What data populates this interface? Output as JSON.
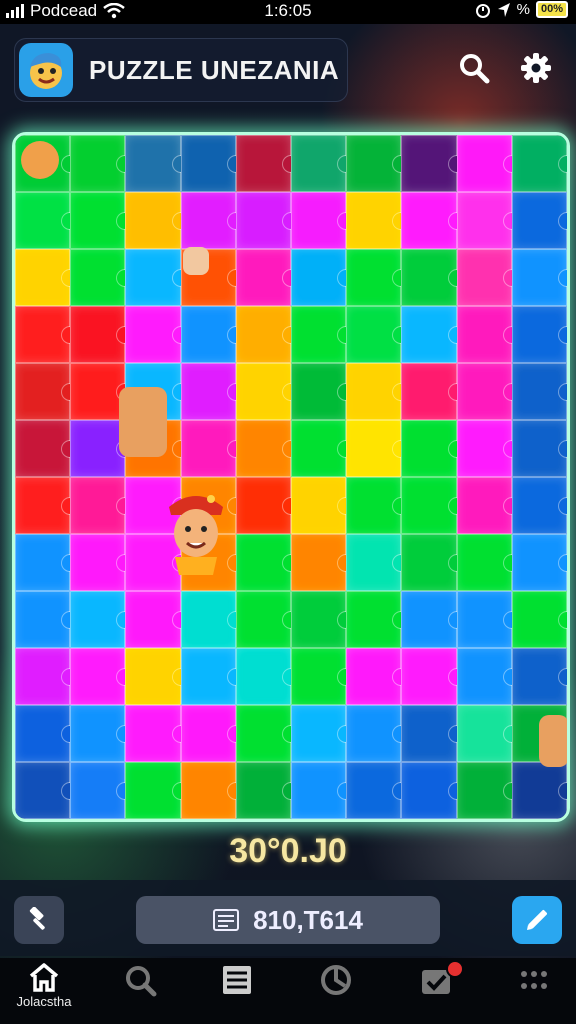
{
  "status_bar": {
    "carrier": "Podcead",
    "time": "1:6:05",
    "battery": "00%",
    "percent_glyph": "%"
  },
  "header": {
    "app_title": "PUZZLE UNEZANIA",
    "search_icon": "search-icon",
    "settings_icon": "gear-icon"
  },
  "board": {
    "columns": 10,
    "rows": 12,
    "tile_colors": [
      [
        "#1fbf4a",
        "#25c247",
        "#2f6f9a",
        "#1f5f9a",
        "#9b1f3a",
        "#2a9e70",
        "#22a84a",
        "#4a1a66",
        "#ff2ad6",
        "#1fa56a"
      ],
      [
        "#21d35a",
        "#1fd24a",
        "#ffbf1f",
        "#c22ad8",
        "#ba2ad8",
        "#d22ad8",
        "#ffd21a",
        "#e02ad8",
        "#ff3fd0",
        "#1e66c0"
      ],
      [
        "#ffd21a",
        "#1fd24a",
        "#2ab0e8",
        "#ff5a1f",
        "#ff2aa8",
        "#1fa8e0",
        "#1fd24a",
        "#22c050",
        "#ff3fa0",
        "#2a8ff0"
      ],
      [
        "#e02a2a",
        "#d01f2a",
        "#e02ad8",
        "#2a8ff0",
        "#ffb01f",
        "#1fd24a",
        "#22d25a",
        "#2ab0e8",
        "#ff2aa8",
        "#1e66c0"
      ],
      [
        "#c02a2a",
        "#ff2a2a",
        "#2ab0e8",
        "#c02ad8",
        "#ffd21a",
        "#1fb04a",
        "#ffd21a",
        "#ff2a6a",
        "#ff2aa8",
        "#1f5fb0"
      ],
      [
        "#a81f3a",
        "#7a2ad8",
        "#ff7a1a",
        "#ff2aa8",
        "#ff8a1a",
        "#1fd24a",
        "#ffe21a",
        "#1fd24a",
        "#e02ad8",
        "#1f5fb0"
      ],
      [
        "#e02a2a",
        "#ff2a8a",
        "#e02ad8",
        "#ff8a1a",
        "#ff3a1a",
        "#ffd21a",
        "#1fd24a",
        "#1fd24a",
        "#ff2aa8",
        "#1e66c0"
      ],
      [
        "#2a8ff0",
        "#ff2ad8",
        "#e02ad8",
        "#ff8a1a",
        "#1fd24a",
        "#ff8a1a",
        "#2ad8b0",
        "#22c050",
        "#1fd24a",
        "#2a8ff0"
      ],
      [
        "#2a8ff0",
        "#2ab0e8",
        "#ff2ad8",
        "#1fd2c8",
        "#1fd24a",
        "#22c050",
        "#1fd24a",
        "#2a8ff0",
        "#2a8ff0",
        "#1fd24a"
      ],
      [
        "#c02ad8",
        "#e02ad8",
        "#ffd21a",
        "#2ab0e8",
        "#1fd2c8",
        "#1fd24a",
        "#ff2ad8",
        "#e02ad8",
        "#2a8ff0",
        "#1f5fb0"
      ],
      [
        "#1e5fc0",
        "#2a8ff0",
        "#e02ad8",
        "#ff2ad8",
        "#1fd24a",
        "#2ab0e8",
        "#2a8ff0",
        "#1f5fb0",
        "#3ad8a0",
        "#1fa54a"
      ],
      [
        "#1e4fa0",
        "#2a7ad8",
        "#1fd24a",
        "#ff8a1a",
        "#1fa54a",
        "#2a8ff0",
        "#1e66c0",
        "#1e5fc0",
        "#1fa54a",
        "#1a3a80"
      ]
    ]
  },
  "score": "30°0.J0",
  "toolbar": {
    "left_icon": "hammer-icon",
    "field_text": "810,T614",
    "field_icon": "list-icon",
    "right_icon": "pencil-icon"
  },
  "tabs": [
    {
      "icon": "home-icon",
      "label": "Jolacstha"
    },
    {
      "icon": "search-reload-icon",
      "label": ""
    },
    {
      "icon": "list-icon",
      "label": ""
    },
    {
      "icon": "clock-icon",
      "label": ""
    },
    {
      "icon": "check-badge-icon",
      "label": ""
    },
    {
      "icon": "more-icon",
      "label": ""
    }
  ],
  "colors": {
    "accent": "#2aa7f0",
    "board_glow": "#b8ffe0",
    "score": "#f6e7a2",
    "badge": "#e53030"
  }
}
